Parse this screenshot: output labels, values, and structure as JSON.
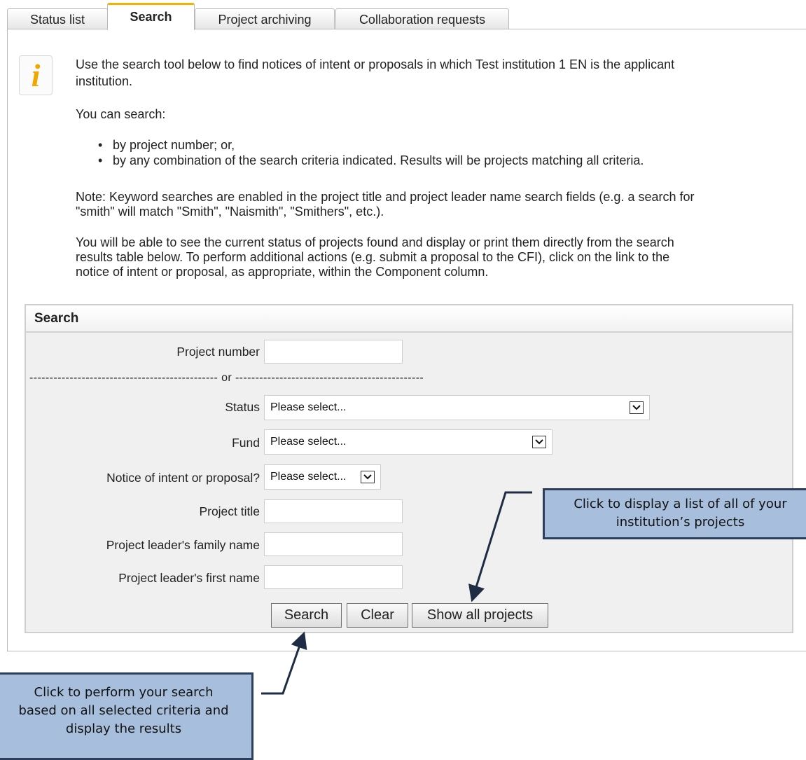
{
  "tabs": [
    {
      "label": "Status list"
    },
    {
      "label": "Search"
    },
    {
      "label": "Project archiving"
    },
    {
      "label": "Collaboration requests"
    }
  ],
  "intro": {
    "line1": "Use the search tool below to find notices of intent or proposals in which Test institution 1 EN is the applicant",
    "line2": "institution.",
    "can_search": "You can search:",
    "bullet1": "by project number; or,",
    "bullet2": "by any combination of the search criteria indicated. Results will be projects matching all criteria.",
    "note1": "Note: Keyword searches are enabled in the project title and project leader name search fields (e.g. a search for",
    "note2": "\"smith\" will match \"Smith\", \"Naismith\", \"Smithers\", etc.).",
    "status1": "You will be able to see the current status of projects found and display or print them directly from the search",
    "status2": "results table below. To perform additional actions (e.g. submit a proposal to the CFI), click on the link to the",
    "status3": "notice of intent or proposal, as appropriate, within the Component column."
  },
  "search": {
    "title": "Search",
    "project_number_label": "Project number",
    "or_divider": "----------------------------------------------- or -----------------------------------------------",
    "status_label": "Status",
    "status_value": "Please select...",
    "fund_label": "Fund",
    "fund_value": "Please select...",
    "noi_label": "Notice of intent or proposal?",
    "noi_value": "Please select...",
    "title_label": "Project title",
    "family_label": "Project leader's family name",
    "first_label": "Project leader's first name",
    "search_button": "Search",
    "clear_button": "Clear",
    "show_all_button": "Show all projects"
  },
  "callouts": {
    "show_all_line1": "Click to display a list of all of your",
    "show_all_line2": "institution’s projects",
    "search_line1": "Click to perform your search",
    "search_line2": "based on all selected criteria and",
    "search_line3": "display the results"
  }
}
